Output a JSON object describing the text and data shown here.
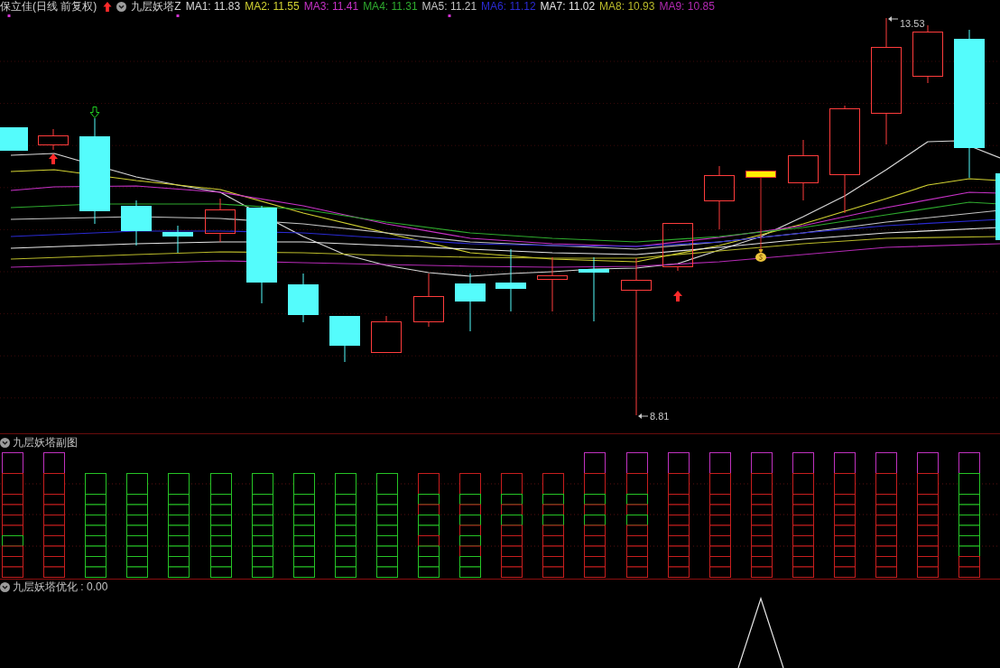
{
  "header": {
    "security": "保立佳(日线 前复权)",
    "indicator": "九层妖塔Z",
    "moving_averages": [
      {
        "label": "MA1: 11.83",
        "color": "#d8d8d8"
      },
      {
        "label": "MA2: 11.55",
        "color": "#d2d232"
      },
      {
        "label": "MA3: 11.41",
        "color": "#c832c8"
      },
      {
        "label": "MA4: 11.31",
        "color": "#2eaa2e"
      },
      {
        "label": "MA5: 11.21",
        "color": "#c4c4c4"
      },
      {
        "label": "MA6: 11.12",
        "color": "#2a2ad2"
      },
      {
        "label": "MA7: 11.02",
        "color": "#e6e6e6"
      },
      {
        "label": "MA8: 10.93",
        "color": "#b9b92a"
      },
      {
        "label": "MA9: 10.85",
        "color": "#b42ab4"
      }
    ]
  },
  "main_chart": {
    "candles": [
      {
        "kind": "fall"
      },
      {
        "kind": "rise"
      },
      {
        "kind": "fall"
      },
      {
        "kind": "fall"
      },
      {
        "kind": "fall"
      },
      {
        "kind": "rise"
      },
      {
        "kind": "fall"
      },
      {
        "kind": "fall"
      },
      {
        "kind": "fall"
      },
      {
        "kind": "rise"
      },
      {
        "kind": "rise"
      },
      {
        "kind": "fall"
      },
      {
        "kind": "fall"
      },
      {
        "kind": "rise"
      },
      {
        "kind": "fall"
      },
      {
        "kind": "rise"
      },
      {
        "kind": "rise"
      },
      {
        "kind": "rise"
      },
      {
        "kind": "signal"
      },
      {
        "kind": "rise"
      },
      {
        "kind": "rise"
      },
      {
        "kind": "rise"
      },
      {
        "kind": "rise"
      },
      {
        "kind": "fall"
      },
      {
        "kind": "fall"
      }
    ],
    "signals": [
      {
        "kind": "buy"
      },
      {
        "kind": "sell"
      },
      {
        "kind": "buy"
      },
      {
        "kind": "bag"
      }
    ],
    "high_label": "13.53",
    "low_label": "8.81"
  },
  "sub_chart": {
    "title": "九层妖塔副图",
    "towers": [
      {
        "cells": [
          {
            "color": "#c032c0"
          },
          {
            "color": "#c81e1e"
          },
          {
            "color": "#c81e1e"
          },
          {
            "color": "#c81e1e"
          },
          {
            "color": "#c81e1e"
          },
          {
            "color": "#c81e1e"
          },
          {
            "color": "#26c426"
          },
          {
            "color": "#c81e1e"
          },
          {
            "color": "#c81e1e"
          },
          {
            "color": "#c81e1e"
          }
        ]
      },
      {
        "cells": [
          {
            "color": "#c032c0"
          },
          {
            "color": "#c81e1e"
          },
          {
            "color": "#c81e1e"
          },
          {
            "color": "#c81e1e"
          },
          {
            "color": "#c81e1e"
          },
          {
            "color": "#c81e1e"
          },
          {
            "color": "#c81e1e"
          },
          {
            "color": "#c81e1e"
          },
          {
            "color": "#c81e1e"
          },
          {
            "color": "#c81e1e"
          }
        ]
      },
      {
        "cells": [
          {
            "color": "#26c426"
          },
          {
            "color": "#26c426"
          },
          {
            "color": "#26c426"
          },
          {
            "color": "#26c426"
          },
          {
            "color": "#26c426"
          },
          {
            "color": "#26c426"
          },
          {
            "color": "#26c426"
          },
          {
            "color": "#26c426"
          },
          {
            "color": "#26c426"
          }
        ]
      },
      {
        "cells": [
          {
            "color": "#26c426"
          },
          {
            "color": "#26c426"
          },
          {
            "color": "#26c426"
          },
          {
            "color": "#26c426"
          },
          {
            "color": "#26c426"
          },
          {
            "color": "#26c426"
          },
          {
            "color": "#26c426"
          },
          {
            "color": "#26c426"
          },
          {
            "color": "#26c426"
          }
        ]
      },
      {
        "cells": [
          {
            "color": "#26c426"
          },
          {
            "color": "#26c426"
          },
          {
            "color": "#26c426"
          },
          {
            "color": "#26c426"
          },
          {
            "color": "#26c426"
          },
          {
            "color": "#26c426"
          },
          {
            "color": "#26c426"
          },
          {
            "color": "#26c426"
          },
          {
            "color": "#26c426"
          }
        ]
      },
      {
        "cells": [
          {
            "color": "#26c426"
          },
          {
            "color": "#26c426"
          },
          {
            "color": "#26c426"
          },
          {
            "color": "#26c426"
          },
          {
            "color": "#26c426"
          },
          {
            "color": "#26c426"
          },
          {
            "color": "#26c426"
          },
          {
            "color": "#26c426"
          },
          {
            "color": "#26c426"
          }
        ]
      },
      {
        "cells": [
          {
            "color": "#26c426"
          },
          {
            "color": "#26c426"
          },
          {
            "color": "#26c426"
          },
          {
            "color": "#26c426"
          },
          {
            "color": "#26c426"
          },
          {
            "color": "#26c426"
          },
          {
            "color": "#26c426"
          },
          {
            "color": "#26c426"
          },
          {
            "color": "#26c426"
          }
        ]
      },
      {
        "cells": [
          {
            "color": "#26c426"
          },
          {
            "color": "#26c426"
          },
          {
            "color": "#26c426"
          },
          {
            "color": "#26c426"
          },
          {
            "color": "#26c426"
          },
          {
            "color": "#26c426"
          },
          {
            "color": "#26c426"
          },
          {
            "color": "#26c426"
          },
          {
            "color": "#26c426"
          }
        ]
      },
      {
        "cells": [
          {
            "color": "#26c426"
          },
          {
            "color": "#26c426"
          },
          {
            "color": "#26c426"
          },
          {
            "color": "#26c426"
          },
          {
            "color": "#26c426"
          },
          {
            "color": "#26c426"
          },
          {
            "color": "#26c426"
          },
          {
            "color": "#26c426"
          },
          {
            "color": "#26c426"
          }
        ]
      },
      {
        "cells": [
          {
            "color": "#26c426"
          },
          {
            "color": "#26c426"
          },
          {
            "color": "#26c426"
          },
          {
            "color": "#26c426"
          },
          {
            "color": "#26c426"
          },
          {
            "color": "#26c426"
          },
          {
            "color": "#26c426"
          },
          {
            "color": "#26c426"
          },
          {
            "color": "#26c426"
          }
        ]
      },
      {
        "cells": [
          {
            "color": "#c81e1e"
          },
          {
            "color": "#26c426"
          },
          {
            "color": "#c81e1e"
          },
          {
            "color": "#26c426"
          },
          {
            "color": "#26c426"
          },
          {
            "color": "#c81e1e"
          },
          {
            "color": "#26c426"
          },
          {
            "color": "#26c426"
          },
          {
            "color": "#26c426"
          }
        ]
      },
      {
        "cells": [
          {
            "color": "#c81e1e"
          },
          {
            "color": "#26c426"
          },
          {
            "color": "#c81e1e"
          },
          {
            "color": "#26c426"
          },
          {
            "color": "#c81e1e"
          },
          {
            "color": "#26c426"
          },
          {
            "color": "#c81e1e"
          },
          {
            "color": "#26c426"
          },
          {
            "color": "#26c426"
          }
        ]
      },
      {
        "cells": [
          {
            "color": "#c81e1e"
          },
          {
            "color": "#26c426"
          },
          {
            "color": "#c81e1e"
          },
          {
            "color": "#26c426"
          },
          {
            "color": "#c81e1e"
          },
          {
            "color": "#c81e1e"
          },
          {
            "color": "#c81e1e"
          },
          {
            "color": "#c81e1e"
          },
          {
            "color": "#c81e1e"
          }
        ]
      },
      {
        "cells": [
          {
            "color": "#c81e1e"
          },
          {
            "color": "#26c426"
          },
          {
            "color": "#c81e1e"
          },
          {
            "color": "#26c426"
          },
          {
            "color": "#c81e1e"
          },
          {
            "color": "#c81e1e"
          },
          {
            "color": "#c81e1e"
          },
          {
            "color": "#c81e1e"
          },
          {
            "color": "#c81e1e"
          }
        ]
      },
      {
        "cells": [
          {
            "color": "#c032c0"
          },
          {
            "color": "#c81e1e"
          },
          {
            "color": "#26c426"
          },
          {
            "color": "#c81e1e"
          },
          {
            "color": "#26c426"
          },
          {
            "color": "#c81e1e"
          },
          {
            "color": "#c81e1e"
          },
          {
            "color": "#c81e1e"
          },
          {
            "color": "#c81e1e"
          },
          {
            "color": "#c81e1e"
          }
        ]
      },
      {
        "cells": [
          {
            "color": "#c032c0"
          },
          {
            "color": "#c81e1e"
          },
          {
            "color": "#26c426"
          },
          {
            "color": "#c81e1e"
          },
          {
            "color": "#26c426"
          },
          {
            "color": "#c81e1e"
          },
          {
            "color": "#c81e1e"
          },
          {
            "color": "#c81e1e"
          },
          {
            "color": "#c81e1e"
          },
          {
            "color": "#c81e1e"
          }
        ]
      },
      {
        "cells": [
          {
            "color": "#c032c0"
          },
          {
            "color": "#c81e1e"
          },
          {
            "color": "#c81e1e"
          },
          {
            "color": "#c81e1e"
          },
          {
            "color": "#c81e1e"
          },
          {
            "color": "#c81e1e"
          },
          {
            "color": "#c81e1e"
          },
          {
            "color": "#c81e1e"
          },
          {
            "color": "#c81e1e"
          },
          {
            "color": "#c81e1e"
          }
        ]
      },
      {
        "cells": [
          {
            "color": "#c032c0"
          },
          {
            "color": "#c81e1e"
          },
          {
            "color": "#c81e1e"
          },
          {
            "color": "#c81e1e"
          },
          {
            "color": "#c81e1e"
          },
          {
            "color": "#c81e1e"
          },
          {
            "color": "#c81e1e"
          },
          {
            "color": "#c81e1e"
          },
          {
            "color": "#c81e1e"
          },
          {
            "color": "#c81e1e"
          }
        ]
      },
      {
        "cells": [
          {
            "color": "#c032c0"
          },
          {
            "color": "#c81e1e"
          },
          {
            "color": "#c81e1e"
          },
          {
            "color": "#c81e1e"
          },
          {
            "color": "#c81e1e"
          },
          {
            "color": "#c81e1e"
          },
          {
            "color": "#c81e1e"
          },
          {
            "color": "#c81e1e"
          },
          {
            "color": "#c81e1e"
          },
          {
            "color": "#c81e1e"
          }
        ]
      },
      {
        "cells": [
          {
            "color": "#c032c0"
          },
          {
            "color": "#c81e1e"
          },
          {
            "color": "#c81e1e"
          },
          {
            "color": "#c81e1e"
          },
          {
            "color": "#c81e1e"
          },
          {
            "color": "#c81e1e"
          },
          {
            "color": "#c81e1e"
          },
          {
            "color": "#c81e1e"
          },
          {
            "color": "#c81e1e"
          },
          {
            "color": "#c81e1e"
          }
        ]
      },
      {
        "cells": [
          {
            "color": "#c032c0"
          },
          {
            "color": "#c81e1e"
          },
          {
            "color": "#c81e1e"
          },
          {
            "color": "#c81e1e"
          },
          {
            "color": "#c81e1e"
          },
          {
            "color": "#c81e1e"
          },
          {
            "color": "#c81e1e"
          },
          {
            "color": "#c81e1e"
          },
          {
            "color": "#c81e1e"
          },
          {
            "color": "#c81e1e"
          }
        ]
      },
      {
        "cells": [
          {
            "color": "#c032c0"
          },
          {
            "color": "#c81e1e"
          },
          {
            "color": "#c81e1e"
          },
          {
            "color": "#c81e1e"
          },
          {
            "color": "#c81e1e"
          },
          {
            "color": "#c81e1e"
          },
          {
            "color": "#c81e1e"
          },
          {
            "color": "#c81e1e"
          },
          {
            "color": "#c81e1e"
          },
          {
            "color": "#c81e1e"
          }
        ]
      },
      {
        "cells": [
          {
            "color": "#c032c0"
          },
          {
            "color": "#c81e1e"
          },
          {
            "color": "#c81e1e"
          },
          {
            "color": "#c81e1e"
          },
          {
            "color": "#c81e1e"
          },
          {
            "color": "#c81e1e"
          },
          {
            "color": "#c81e1e"
          },
          {
            "color": "#c81e1e"
          },
          {
            "color": "#c81e1e"
          },
          {
            "color": "#c81e1e"
          }
        ]
      },
      {
        "cells": [
          {
            "color": "#c032c0"
          },
          {
            "color": "#26c426"
          },
          {
            "color": "#26c426"
          },
          {
            "color": "#26c426"
          },
          {
            "color": "#26c426"
          },
          {
            "color": "#26c426"
          },
          {
            "color": "#26c426"
          },
          {
            "color": "#26c426"
          },
          {
            "color": "#c81e1e"
          },
          {
            "color": "#c81e1e"
          }
        ]
      }
    ]
  },
  "bottom_chart": {
    "title": "九层妖塔优化 : 0.00"
  }
}
